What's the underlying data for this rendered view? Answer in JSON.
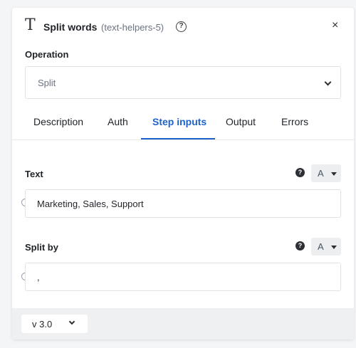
{
  "header": {
    "icon": "text-type-icon",
    "icon_glyph": "T",
    "title": "Split words",
    "subtitle": "(text-helpers-5)",
    "help_glyph": "?",
    "close_glyph": "×"
  },
  "operation": {
    "label": "Operation",
    "value": "Split"
  },
  "tabs": [
    {
      "label": "Description",
      "active": false
    },
    {
      "label": "Auth",
      "active": false
    },
    {
      "label": "Step inputs",
      "active": true
    },
    {
      "label": "Output",
      "active": false
    },
    {
      "label": "Errors",
      "active": false
    }
  ],
  "fields": [
    {
      "label": "Text",
      "help_glyph": "?",
      "type_label": "A",
      "value": "Marketing, Sales, Support"
    },
    {
      "label": "Split by",
      "help_glyph": "?",
      "type_label": "A",
      "value": ","
    }
  ],
  "footer": {
    "version": "v 3.0"
  },
  "colors": {
    "accent": "#1e63c9",
    "footer_bg": "#eef0f2"
  }
}
